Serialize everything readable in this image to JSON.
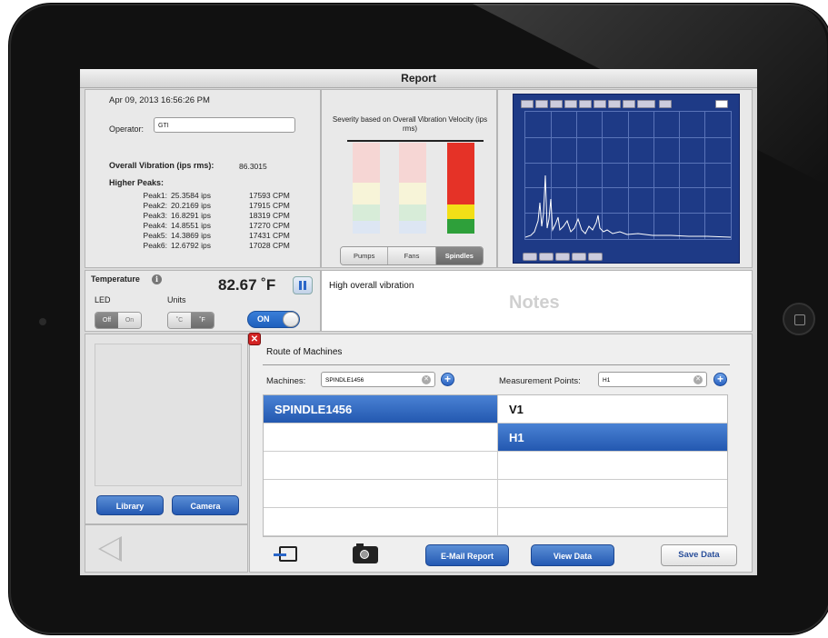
{
  "window": {
    "title": "Report"
  },
  "info": {
    "datetime": "Apr 09, 2013  16:56:26 PM",
    "operator_label": "Operator:",
    "operator_value": "GTI",
    "overall_label": "Overall Vibration (ips rms):",
    "overall_value": "86.3015",
    "higher_peaks_label": "Higher Peaks:",
    "peaks": [
      {
        "name": "Peak1:",
        "value": "25.3584 ips",
        "cpm": "17593 CPM"
      },
      {
        "name": "Peak2:",
        "value": "20.2169 ips",
        "cpm": "17915 CPM"
      },
      {
        "name": "Peak3:",
        "value": "16.8291 ips",
        "cpm": "18319 CPM"
      },
      {
        "name": "Peak4:",
        "value": "14.8551 ips",
        "cpm": "17270 CPM"
      },
      {
        "name": "Peak5:",
        "value": "14.3869 ips",
        "cpm": "17431 CPM"
      },
      {
        "name": "Peak6:",
        "value": "12.6792 ips",
        "cpm": "17028 CPM"
      }
    ]
  },
  "severity": {
    "title": "Severity based on Overall Vibration Velocity (ips rms)",
    "tabs": [
      "Pumps",
      "Fans",
      "Spindles"
    ],
    "active_tab": "Spindles",
    "colors": {
      "red": "#e53227",
      "yellow": "#f3df17",
      "green": "#2ea03a",
      "pale_red": "#f6d6d4",
      "pale_yellow": "#f7f4d8",
      "pale_green": "#d7ecd8",
      "pale_blue": "#dde6f3"
    }
  },
  "temperature": {
    "label": "Temperature",
    "value": "82.67 ˚F",
    "led_label": "LED",
    "led_options": [
      "Off",
      "On"
    ],
    "units_label": "Units",
    "units_options": [
      "˚C",
      "˚F"
    ],
    "units_selected": "˚F",
    "toggle_label": "ON"
  },
  "notes": {
    "text": "High overall vibration",
    "placeholder": "Notes"
  },
  "media": {
    "library_button": "Library",
    "camera_button": "Camera"
  },
  "route": {
    "title": "Route of Machines",
    "machines_label": "Machines:",
    "machines_value": "SPINDLE1456",
    "points_label": "Measurement Points:",
    "points_value": "H1",
    "machines_list": [
      "SPINDLE1456",
      "",
      "",
      "",
      ""
    ],
    "points_list": [
      "V1",
      "H1",
      "",
      "",
      ""
    ],
    "selected_machine": "SPINDLE1456",
    "selected_point": "H1"
  },
  "toolbar": {
    "email_button": "E-Mail Report",
    "view_button": "View Data",
    "save_button": "Save Data"
  },
  "colors": {
    "accent_blue": "#2459b3",
    "close_red": "#d32424"
  }
}
